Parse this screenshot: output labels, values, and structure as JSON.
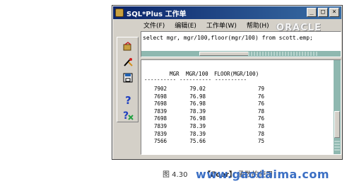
{
  "window": {
    "title": "SQL*Plus 工作单",
    "controls": [
      "_",
      "□",
      "×"
    ]
  },
  "menu": [
    "文件(F)",
    "编辑(E)",
    "工作单(W)",
    "帮助(H)"
  ],
  "brand": "ORACLE",
  "toolbar": {
    "icons": [
      "open-icon",
      "clear-icon",
      "save-icon",
      "help-icon",
      "help-context-icon"
    ]
  },
  "command": "select mgr, mgr/100,floor(mgr/100) from scott.emp;",
  "output": {
    "columns": [
      "MGR",
      "MGR/100",
      "FLOOR(MGR/100)"
    ],
    "separator": "----------",
    "rows": [
      [
        "7902",
        "79.02",
        "79"
      ],
      [
        "7698",
        "76.98",
        "76"
      ],
      [
        "7698",
        "76.98",
        "76"
      ],
      [
        "7839",
        "78.39",
        "78"
      ],
      [
        "7698",
        "76.98",
        "76"
      ],
      [
        "7839",
        "78.39",
        "78"
      ],
      [
        "7839",
        "78.39",
        "78"
      ],
      [
        "7566",
        "75.66",
        "75"
      ]
    ]
  },
  "caption": {
    "figure": "图 4.30",
    "keyword": "【floor】",
    "text": "函数的使用"
  },
  "watermark": "www.gaodaima.com"
}
